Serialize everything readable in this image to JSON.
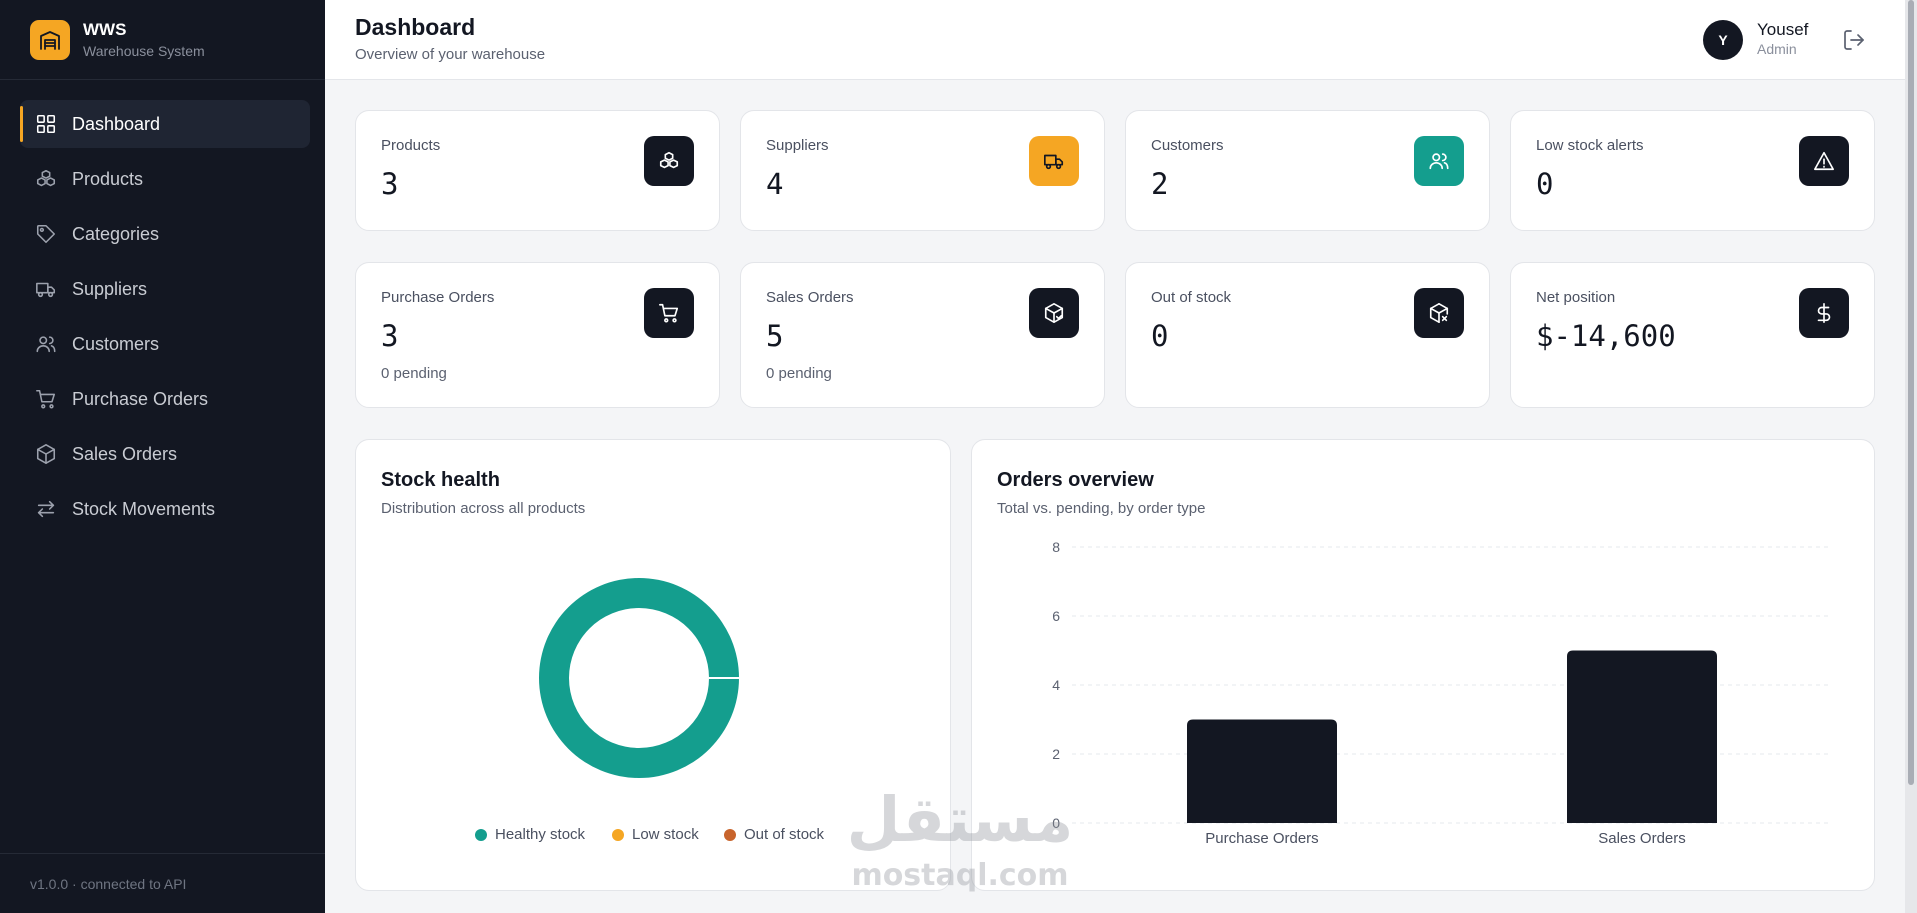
{
  "brand": {
    "title": "WWS",
    "subtitle": "Warehouse System"
  },
  "sidebar": {
    "items": [
      {
        "label": "Dashboard",
        "icon": "grid-icon",
        "active": true
      },
      {
        "label": "Products",
        "icon": "boxes-icon"
      },
      {
        "label": "Categories",
        "icon": "tag-icon"
      },
      {
        "label": "Suppliers",
        "icon": "truck-icon"
      },
      {
        "label": "Customers",
        "icon": "users-icon"
      },
      {
        "label": "Purchase Orders",
        "icon": "cart-icon"
      },
      {
        "label": "Sales Orders",
        "icon": "package-icon"
      },
      {
        "label": "Stock Movements",
        "icon": "arrows-icon"
      }
    ],
    "footer": "v1.0.0 · connected to API"
  },
  "header": {
    "title": "Dashboard",
    "subtitle": "Overview of your warehouse",
    "user": {
      "initial": "Y",
      "name": "Yousef",
      "role": "Admin"
    }
  },
  "stats": [
    {
      "label": "Products",
      "value": "3",
      "icon": "boxes-icon",
      "icon_bg": "#131722"
    },
    {
      "label": "Suppliers",
      "value": "4",
      "icon": "truck-icon",
      "icon_bg": "#f5a623"
    },
    {
      "label": "Customers",
      "value": "2",
      "icon": "users-icon",
      "icon_bg": "#149e8e"
    },
    {
      "label": "Low stock alerts",
      "value": "0",
      "icon": "alert-triangle-icon",
      "icon_bg": "#131722"
    },
    {
      "label": "Purchase Orders",
      "value": "3",
      "sub": "0 pending",
      "icon": "cart-icon",
      "icon_bg": "#131722"
    },
    {
      "label": "Sales Orders",
      "value": "5",
      "sub": "0 pending",
      "icon": "package-check-icon",
      "icon_bg": "#131722"
    },
    {
      "label": "Out of stock",
      "value": "0",
      "icon": "package-x-icon",
      "icon_bg": "#131722"
    },
    {
      "label": "Net position",
      "value": "$-14,600",
      "icon": "dollar-icon",
      "icon_bg": "#131722"
    }
  ],
  "stock_health": {
    "title": "Stock health",
    "subtitle": "Distribution across all products"
  },
  "orders_overview": {
    "title": "Orders overview",
    "subtitle": "Total vs. pending, by order type"
  },
  "chart_data": [
    {
      "type": "pie",
      "title": "Stock health",
      "categories": [
        "Healthy stock",
        "Low stock",
        "Out of stock"
      ],
      "values": [
        3,
        0,
        0
      ],
      "colors": [
        "#149e8e",
        "#f5a623",
        "#c8642c"
      ],
      "legend": "bottom"
    },
    {
      "type": "bar",
      "title": "Orders overview",
      "categories": [
        "Purchase Orders",
        "Sales Orders"
      ],
      "values": [
        3,
        5
      ],
      "yticks": [
        0,
        2,
        4,
        6,
        8
      ],
      "ylim": [
        0,
        8
      ],
      "grid": true,
      "color": "#131722"
    }
  ],
  "watermark": {
    "arabic": "مستقل",
    "latin": "mostaql.com"
  }
}
